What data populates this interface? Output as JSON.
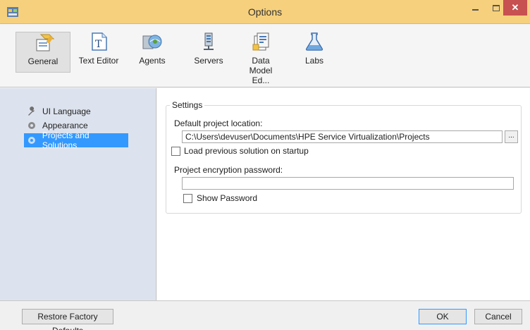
{
  "window": {
    "title": "Options",
    "minimize_glyph": "–",
    "close_glyph": "✕"
  },
  "toolbar": {
    "items": [
      {
        "label": "General",
        "icon": "general-icon",
        "active": true
      },
      {
        "label": "Text Editor",
        "icon": "text-editor-icon"
      },
      {
        "label": "Agents",
        "icon": "agents-icon"
      },
      {
        "label": "Servers",
        "icon": "servers-icon"
      },
      {
        "label_line1": "Data",
        "label_line2": "Model Ed...",
        "icon": "data-model-icon"
      },
      {
        "label": "Labs",
        "icon": "labs-flask-icon"
      }
    ]
  },
  "sidebar": {
    "items": [
      {
        "label": "UI Language",
        "icon": "wrench-icon"
      },
      {
        "label": "Appearance",
        "icon": "gear-icon"
      },
      {
        "label": "Projects and Solutions",
        "icon": "gear-icon",
        "selected": true
      }
    ]
  },
  "settings": {
    "legend": "Settings",
    "default_location_label": "Default project location:",
    "default_location_value": "C:\\Users\\devuser\\Documents\\HPE Service Virtualization\\Projects",
    "browse_label": "...",
    "load_previous_label": "Load previous solution on startup",
    "load_previous_checked": false,
    "encryption_label": "Project encryption password:",
    "encryption_value": "",
    "show_password_label": "Show Password",
    "show_password_checked": false
  },
  "footer": {
    "restore_label": "Restore Factory Defaults",
    "ok_label": "OK",
    "cancel_label": "Cancel"
  },
  "colors": {
    "titlebar": "#f6d07c",
    "selection": "#3399ff",
    "close_button": "#c75050",
    "sidebar": "#dde3ee"
  }
}
